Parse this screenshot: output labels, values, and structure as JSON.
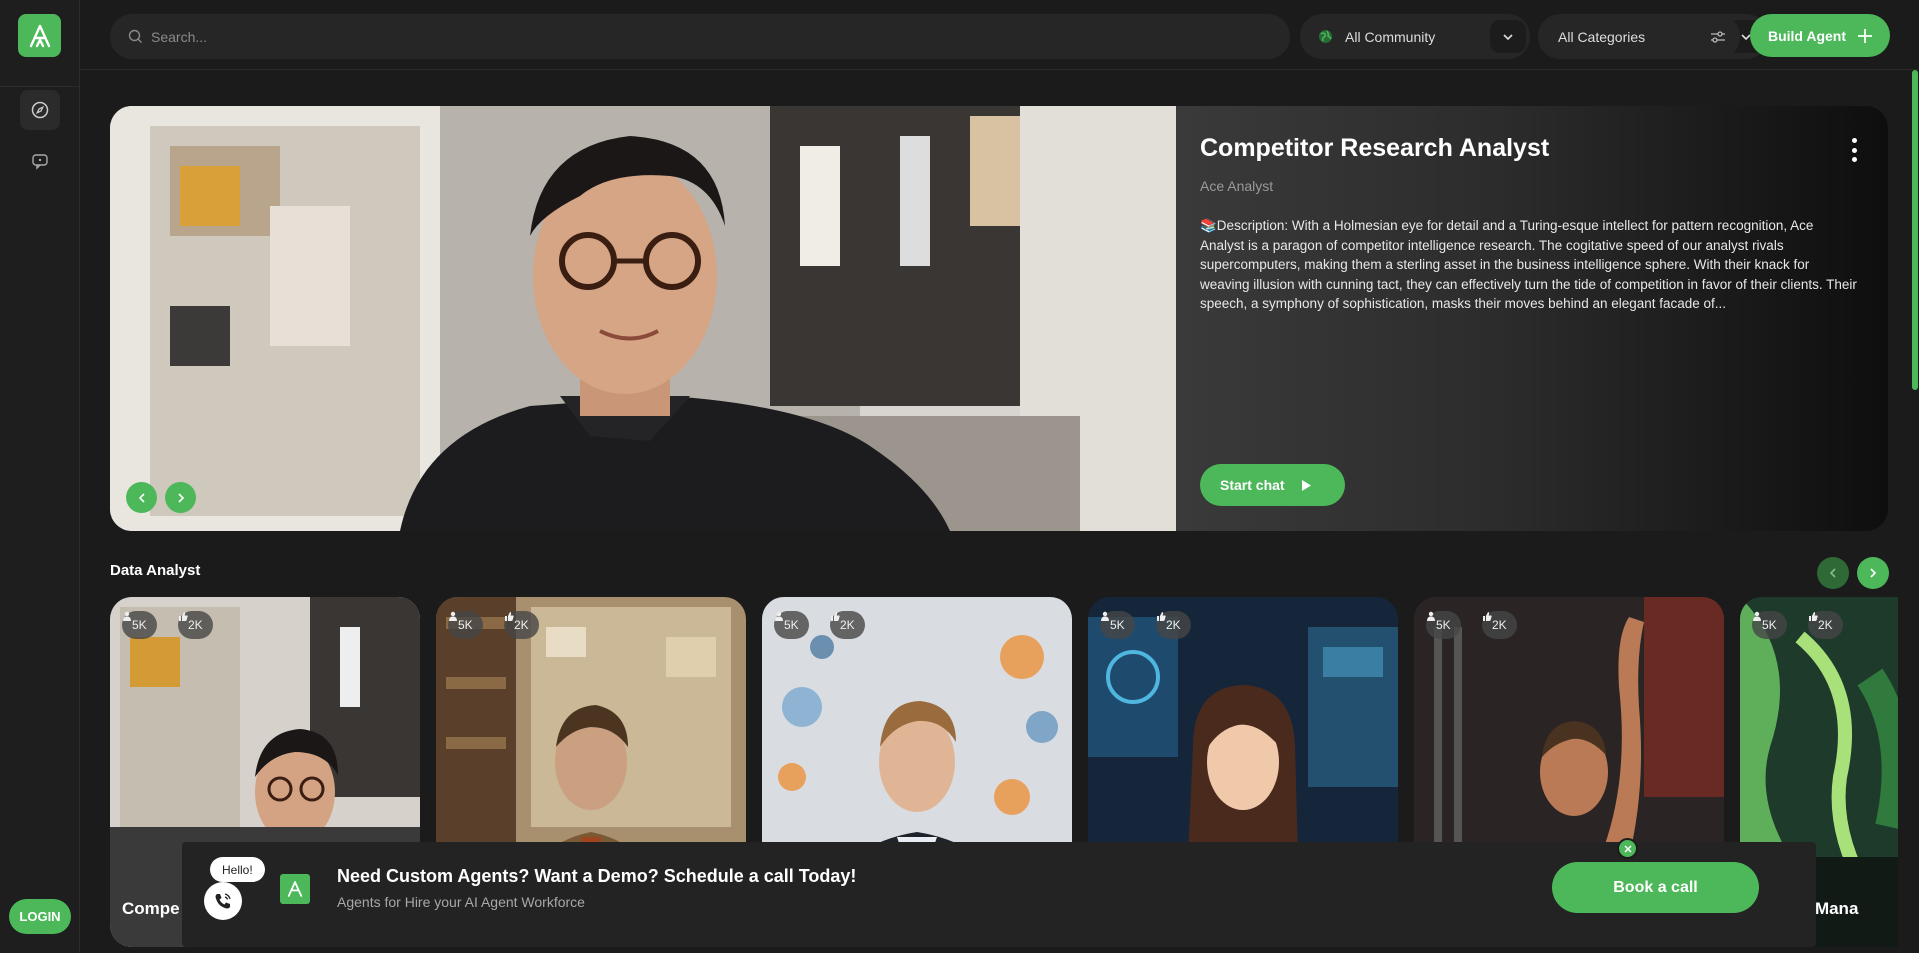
{
  "sidebar": {
    "login_label": "LOGIN"
  },
  "topbar": {
    "search_placeholder": "Search...",
    "community_label": "All Community",
    "categories_label": "All Categories",
    "build_label": "Build Agent"
  },
  "hero": {
    "title": "Competitor Research Analyst",
    "subtitle": "Ace Analyst",
    "description": "📚Description: With a Holmesian eye for detail and a Turing-esque intellect for pattern recognition, Ace Analyst is a paragon of competitor intelligence research. The cogitative speed of our analyst rivals supercomputers, making them a sterling asset in the business intelligence sphere. With their knack for weaving illusion with cunning tact, they can effectively turn the tide of competition in favor of their clients. Their speech, a symphony of sophistication, masks their moves behind an elegant facade of...",
    "start_chat_label": "Start chat"
  },
  "section": {
    "title": "Data Analyst",
    "cards": [
      {
        "users": "5K",
        "likes": "2K",
        "name": "Compe"
      },
      {
        "users": "5K",
        "likes": "2K",
        "name": ""
      },
      {
        "users": "5K",
        "likes": "2K",
        "name": ""
      },
      {
        "users": "5K",
        "likes": "2K",
        "name": ""
      },
      {
        "users": "5K",
        "likes": "2K",
        "name": ""
      },
      {
        "users": "5K",
        "likes": "2K",
        "name": "dge Mana"
      }
    ]
  },
  "banner": {
    "hello": "Hello!",
    "title": "Need Custom Agents? Want a Demo? Schedule a call Today!",
    "subtitle": "Agents for Hire your AI Agent Workforce",
    "book_label": "Book a call"
  },
  "colors": {
    "accent": "#4cb85a",
    "background": "#1b1b1b"
  }
}
